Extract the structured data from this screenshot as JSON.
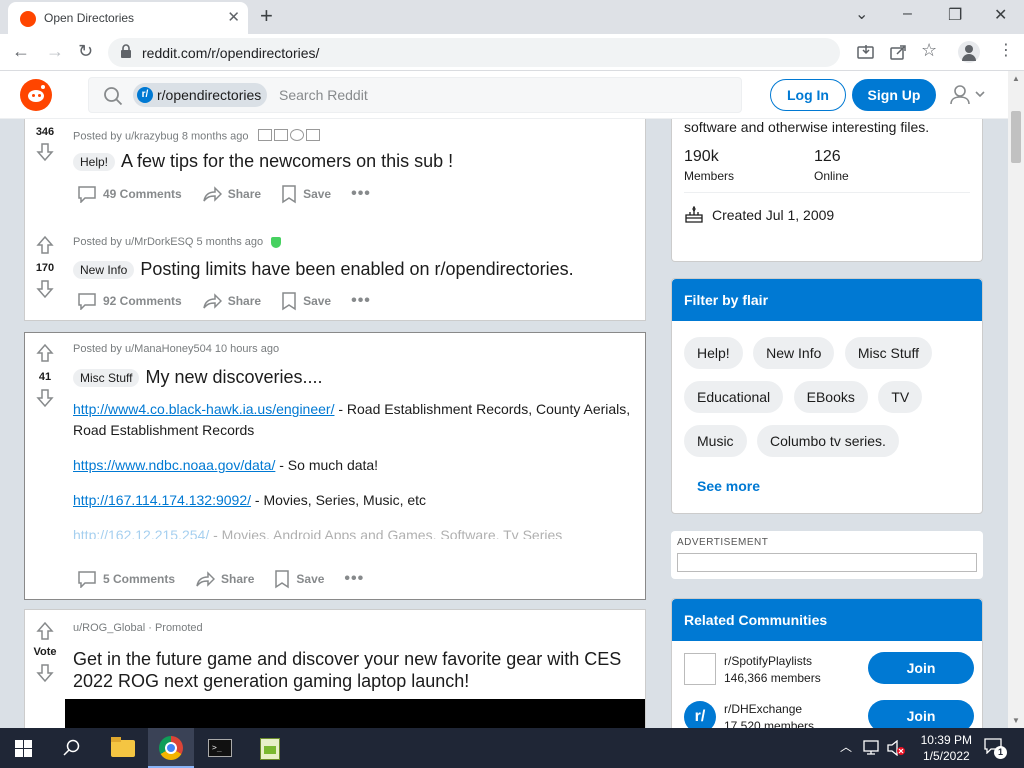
{
  "browser": {
    "tab_title": "Open Directories",
    "tab_close": "✕",
    "new_tab": "+",
    "url": "reddit.com/r/opendirectories/",
    "win_min": "⌄",
    "win_minimize": "–",
    "win_restore": "❐",
    "win_close": "✕"
  },
  "reddit_header": {
    "subreddit_pill": "r/opendirectories",
    "search_placeholder": "Search Reddit",
    "login_label": "Log In",
    "signup_label": "Sign Up"
  },
  "posts": [
    {
      "votes": "346",
      "meta": "Posted by u/krazybug 8 months ago",
      "flair": "Help!",
      "title": "A few tips for the newcomers on this sub !",
      "comments": "49 Comments",
      "share": "Share",
      "save": "Save"
    },
    {
      "votes": "170",
      "meta": "Posted by u/MrDorkESQ 5 months ago",
      "flair": "New Info",
      "title": "Posting limits have been enabled on r/opendirectories.",
      "comments": "92 Comments",
      "share": "Share",
      "save": "Save"
    },
    {
      "votes": "41",
      "meta": "Posted by u/ManaHoney504 10 hours ago",
      "flair": "Misc Stuff",
      "title": "My new discoveries....",
      "links": [
        {
          "url": "http://www4.co.black-hawk.ia.us/engineer/",
          "desc": " - Road Establishment Records, County Aerials, Road Establishment Records"
        },
        {
          "url": "https://www.ndbc.noaa.gov/data/",
          "desc": " - So much data!"
        },
        {
          "url": "http://167.114.174.132:9092/",
          "desc": " - Movies, Series, Music, etc"
        },
        {
          "url": "http://162.12.215.254/",
          "desc": " - Movies, Android Apps and Games, Software, Tv Series"
        }
      ],
      "comments": "5 Comments",
      "share": "Share",
      "save": "Save"
    },
    {
      "votes": "Vote",
      "meta_user": "u/ROG_Global",
      "meta_sep": " · ",
      "meta_promoted": "Promoted",
      "title": "Get in the future game and discover your new favorite gear with CES 2022 ROG next generation gaming laptop launch!"
    }
  ],
  "sidebar": {
    "about_tail": "software and otherwise interesting files.",
    "members_count": "190k",
    "members_label": "Members",
    "online_count": "126",
    "online_label": "Online",
    "created": "Created Jul 1, 2009",
    "filter_title": "Filter by flair",
    "flairs": [
      "Help!",
      "New Info",
      "Misc Stuff",
      "Educational",
      "EBooks",
      "TV",
      "Music",
      "Columbo tv series."
    ],
    "see_more": "See more",
    "ad_label": "ADVERTISEMENT",
    "related_title": "Related Communities",
    "related": [
      {
        "name": "r/SpotifyPlaylists",
        "members": "146,366 members",
        "join": "Join"
      },
      {
        "name": "r/DHExchange",
        "members": "17,520 members",
        "join": "Join"
      }
    ]
  },
  "taskbar": {
    "time": "10:39 PM",
    "date": "1/5/2022",
    "notification_count": "1"
  },
  "colors": {
    "reddit_orange": "#ff4500",
    "reddit_blue": "#0079d3",
    "page_bg": "#dae0e6"
  }
}
